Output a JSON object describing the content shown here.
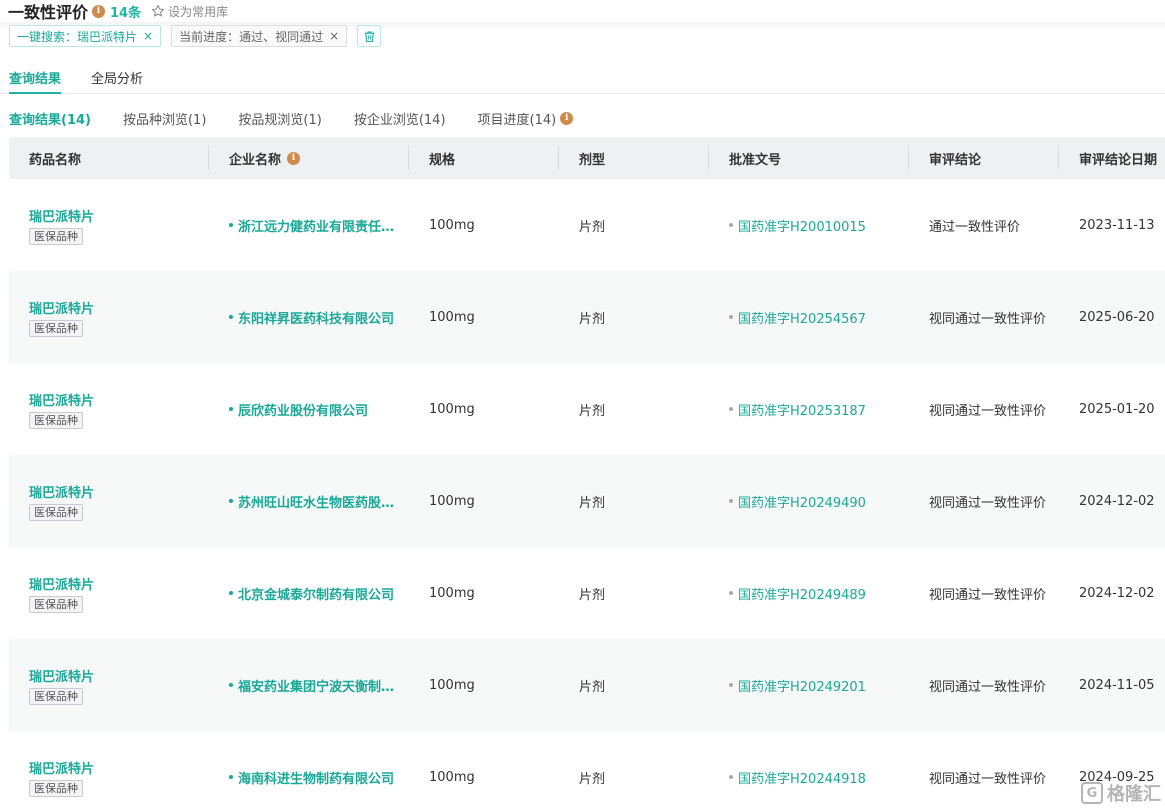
{
  "header": {
    "title": "一致性评价",
    "info_glyph": "i",
    "count": "14条",
    "favorite_label": "设为常用库"
  },
  "filters": [
    {
      "label": "一键搜索：瑞巴派特片",
      "close": "×"
    },
    {
      "label": "当前进度：通过、视同通过",
      "close": "×"
    }
  ],
  "main_tabs": [
    {
      "label": "查询结果",
      "active": true
    },
    {
      "label": "全局分析",
      "active": false
    }
  ],
  "sub_tabs": [
    {
      "label": "查询结果(14)",
      "active": true
    },
    {
      "label": "按品种浏览(1)"
    },
    {
      "label": "按品规浏览(1)"
    },
    {
      "label": "按企业浏览(14)"
    },
    {
      "label": "项目进度(14)"
    }
  ],
  "table": {
    "columns": [
      "药品名称",
      "企业名称",
      "规格",
      "剂型",
      "批准文号",
      "审评结论",
      "审评结论日期"
    ],
    "rows": [
      {
        "drug": "瑞巴派特片",
        "badge": "医保品种",
        "company": "浙江远力健药业有限责任…",
        "spec": "100mg",
        "form": "片剂",
        "approval": "国药准字H20010015",
        "conclusion": "通过一致性评价",
        "date": "2023-11-13"
      },
      {
        "drug": "瑞巴派特片",
        "badge": "医保品种",
        "company": "东阳祥昇医药科技有限公司",
        "spec": "100mg",
        "form": "片剂",
        "approval": "国药准字H20254567",
        "conclusion": "视同通过一致性评价",
        "date": "2025-06-20"
      },
      {
        "drug": "瑞巴派特片",
        "badge": "医保品种",
        "company": "辰欣药业股份有限公司",
        "spec": "100mg",
        "form": "片剂",
        "approval": "国药准字H20253187",
        "conclusion": "视同通过一致性评价",
        "date": "2025-01-20"
      },
      {
        "drug": "瑞巴派特片",
        "badge": "医保品种",
        "company": "苏州旺山旺水生物医药股…",
        "spec": "100mg",
        "form": "片剂",
        "approval": "国药准字H20249490",
        "conclusion": "视同通过一致性评价",
        "date": "2024-12-02"
      },
      {
        "drug": "瑞巴派特片",
        "badge": "医保品种",
        "company": "北京金城泰尔制药有限公司",
        "spec": "100mg",
        "form": "片剂",
        "approval": "国药准字H20249489",
        "conclusion": "视同通过一致性评价",
        "date": "2024-12-02"
      },
      {
        "drug": "瑞巴派特片",
        "badge": "医保品种",
        "company": "福安药业集团宁波天衡制…",
        "spec": "100mg",
        "form": "片剂",
        "approval": "国药准字H20249201",
        "conclusion": "视同通过一致性评价",
        "date": "2024-11-05"
      },
      {
        "drug": "瑞巴派特片",
        "badge": "医保品种",
        "company": "海南科进生物制药有限公司",
        "spec": "100mg",
        "form": "片剂",
        "approval": "国药准字H20244918",
        "conclusion": "视同通过一致性评价",
        "date": "2024-09-25"
      }
    ]
  },
  "watermark": {
    "logo": "G",
    "text": "格隆汇"
  },
  "colors": {
    "accent": "#1aa999",
    "info": "#d08a4a",
    "header_bg": "#eef1f2",
    "row_alt": "#f7f8f8"
  },
  "icons": [
    "info-icon",
    "star-outline-icon",
    "close-icon",
    "trash-icon"
  ]
}
